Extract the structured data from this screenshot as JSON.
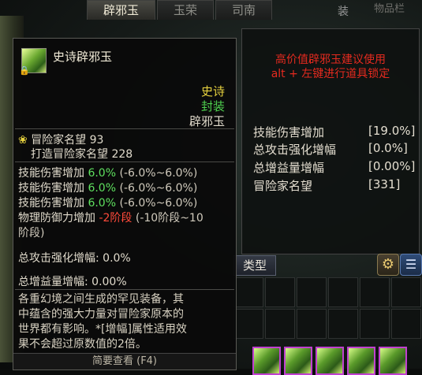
{
  "tabs": [
    {
      "label": "辟邪玉",
      "active": true
    },
    {
      "label": "玉荣",
      "active": false
    },
    {
      "label": "司南",
      "active": false
    }
  ],
  "tab_extra": "装",
  "tab_extra2": "物品栏",
  "right_panel": {
    "warning_line1": "高价值辟邪玉建议使用",
    "warning_line2": "alt + 左键进行道具锁定",
    "stats": [
      {
        "label": "技能伤害增加",
        "value": "[19.0%]"
      },
      {
        "label": "总攻击强化增幅",
        "value": "[0.0%]"
      },
      {
        "label": "总增益量增幅",
        "value": "[0.00%]"
      },
      {
        "label": "冒险家名望",
        "value": "[331]"
      }
    ]
  },
  "controls": {
    "type_button": "类型",
    "gear_icon": "gear-icon",
    "list_icon": "list-icon"
  },
  "tooltip": {
    "item_name": "史诗辟邪玉",
    "rarity": "史诗",
    "bind": "封装",
    "category": "辟邪玉",
    "fame_label": "冒险家名望",
    "fame_value": "93",
    "craft_fame_label": "打造冒险家名望",
    "craft_fame_value": "228",
    "effects": [
      {
        "name": "技能伤害增加",
        "value": "6.0%",
        "range": "(-6.0%~6.0%)"
      },
      {
        "name": "技能伤害增加",
        "value": "6.0%",
        "range": "(-6.0%~6.0%)"
      },
      {
        "name": "技能伤害增加",
        "value": "6.0%",
        "range": "(-6.0%~6.0%)"
      }
    ],
    "defense_name": "物理防御力增加",
    "defense_value": "-2阶段",
    "defense_range_a": "(-10阶段~10",
    "defense_range_b": "阶段)",
    "attack_amp": "总攻击强化增幅: 0.0%",
    "buff_amp": "总增益量增幅: 0.00%",
    "desc_lines": [
      "各重幻境之间生成的罕见装备，其",
      "中蕴含的强大力量对冒险家原本的",
      "世界都有影响。*[增幅]属性适用效",
      "果不会超过原数值的2倍。"
    ],
    "footer": "简要查看 (F4)"
  },
  "colors": {
    "rarity": "#e8d33f",
    "bind": "#4fd24f",
    "warning": "#e52a1f",
    "positive": "#5fe05f",
    "negative": "#ff4a3a"
  }
}
